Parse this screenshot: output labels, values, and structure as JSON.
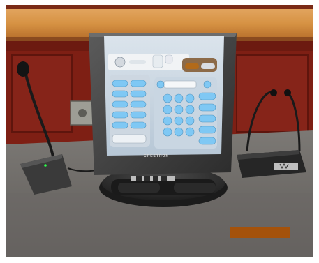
{
  "scene": {
    "brand_label": "CRESTRON"
  },
  "touchpanel": {
    "colors": {
      "screen_bg": "#c9d6e2",
      "button_blue": "#7fc8f4",
      "panel_frame": "#4a4a4a",
      "accent_orange": "#b26a1a"
    },
    "icons": [
      "seal-icon",
      "speaker-icon",
      "numeric-keypad",
      "microphone-icon",
      "headset-icon"
    ]
  }
}
